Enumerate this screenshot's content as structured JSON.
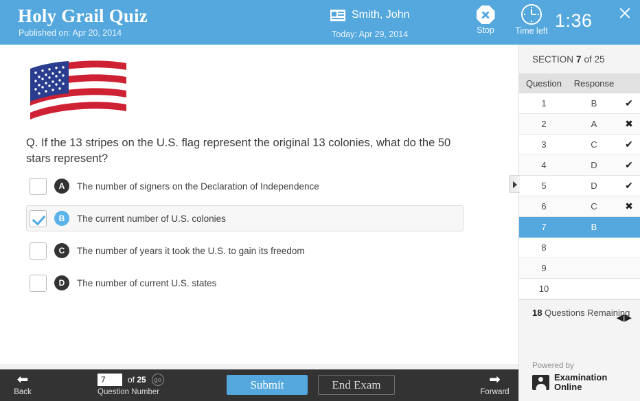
{
  "header": {
    "title": "Holy Grail Quiz",
    "published": "Published on: Apr 20, 2014",
    "user_name": "Smith, John",
    "today": "Today: Apr 29, 2014",
    "stop_label": "Stop",
    "time_left_label": "Time left",
    "timer": "1:36",
    "accent_color": "#54a8de"
  },
  "main": {
    "question": "Q. If the 13 stripes on the U.S. flag represent the original 13 colonies, what do the 50 stars represent?",
    "options": [
      {
        "letter": "A",
        "text": "The number of signers on the Declaration of Independence",
        "selected": false
      },
      {
        "letter": "B",
        "text": "The current number of U.S. colonies",
        "selected": true
      },
      {
        "letter": "C",
        "text": "The number of years it took the U.S. to gain its freedom",
        "selected": false
      },
      {
        "letter": "D",
        "text": "The number of current U.S. states",
        "selected": false
      }
    ]
  },
  "sidebar": {
    "section_prefix": "SECTION",
    "section_number": "7",
    "section_suffix": "of 25",
    "columns": {
      "question": "Question",
      "response": "Response"
    },
    "rows": [
      {
        "question": "1",
        "response": "B",
        "mark": "✔",
        "active": false
      },
      {
        "question": "2",
        "response": "A",
        "mark": "✖",
        "active": false
      },
      {
        "question": "3",
        "response": "C",
        "mark": "✔",
        "active": false
      },
      {
        "question": "4",
        "response": "D",
        "mark": "✔",
        "active": false
      },
      {
        "question": "5",
        "response": "D",
        "mark": "✔",
        "active": false
      },
      {
        "question": "6",
        "response": "C",
        "mark": "✖",
        "active": false
      },
      {
        "question": "7",
        "response": "B",
        "mark": "",
        "active": true
      },
      {
        "question": "8",
        "response": "",
        "mark": "",
        "active": false
      },
      {
        "question": "9",
        "response": "",
        "mark": "",
        "active": false
      },
      {
        "question": "10",
        "response": "",
        "mark": "",
        "active": false
      }
    ],
    "remaining_count": "18",
    "remaining_label": "Questions Remaining",
    "prev_arrow": "◀",
    "next_arrow": "▶",
    "powered_by": "Powered by",
    "brand_line1": "Examination",
    "brand_line2": "Online"
  },
  "bottombar": {
    "back_label": "Back",
    "back_arrow": "⬅",
    "forward_label": "Forward",
    "forward_arrow": "➡",
    "question_number_value": "7",
    "of_text": "of",
    "total_questions": "25",
    "go_label": "go",
    "question_number_label": "Question Number",
    "submit_label": "Submit",
    "end_exam_label": "End Exam"
  }
}
